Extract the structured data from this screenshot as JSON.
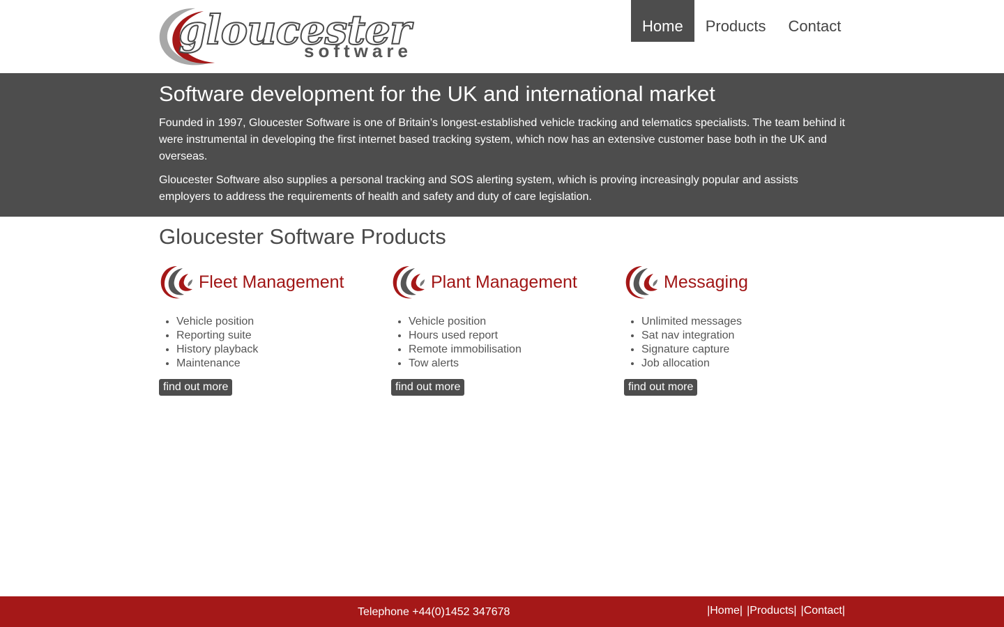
{
  "brand": {
    "logo_word": "gloucester",
    "logo_sub": "software"
  },
  "nav": {
    "items": [
      {
        "label": "Home",
        "active": true
      },
      {
        "label": "Products",
        "active": false
      },
      {
        "label": "Contact",
        "active": false
      }
    ]
  },
  "hero": {
    "title": "Software development for the UK and international market",
    "paragraphs": [
      "Founded in 1997, Gloucester Software is one of Britain’s longest-established vehicle tracking and telematics specialists. The team behind it were instrumental in developing the first internet based tracking system, which now has an extensive customer base both in the UK and overseas.",
      "Gloucester Software also supplies a personal tracking and SOS alerting system, which is proving increasingly popular and assists employers to address the requirements of health and safety and duty of care legislation."
    ]
  },
  "products": {
    "title": "Gloucester Software Products",
    "items": [
      {
        "name": "Fleet Management",
        "features": [
          "Vehicle position",
          "Reporting suite",
          "History playback",
          "Maintenance"
        ],
        "button": "find out more"
      },
      {
        "name": "Plant Management",
        "features": [
          "Vehicle position",
          "Hours used report",
          "Remote immobilisation",
          "Tow alerts"
        ],
        "button": "find out more"
      },
      {
        "name": "Messaging",
        "features": [
          "Unlimited messages",
          "Sat nav integration",
          "Signature capture",
          "Job allocation"
        ],
        "button": "find out more"
      }
    ]
  },
  "footer": {
    "phone": "Telephone +44(0)1452 347678",
    "links": [
      "|Home|",
      "|Products|",
      "|Contact|"
    ]
  },
  "colors": {
    "accent_red": "#a51818",
    "dark_gray": "#4d4d4d",
    "text_gray": "#444444"
  }
}
